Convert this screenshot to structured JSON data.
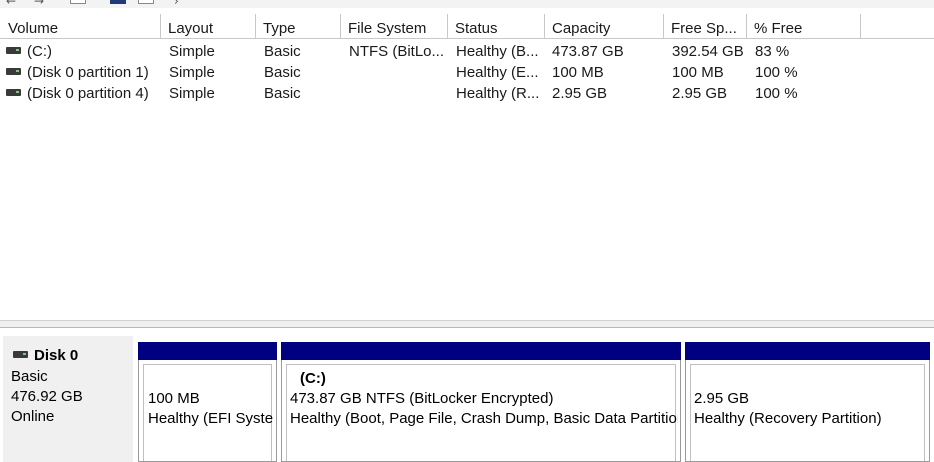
{
  "columns": [
    "Volume",
    "Layout",
    "Type",
    "File System",
    "Status",
    "Capacity",
    "Free Sp...",
    "% Free"
  ],
  "volumes": [
    {
      "volume": "(C:)",
      "layout": "Simple",
      "type": "Basic",
      "fs": "NTFS (BitLo...",
      "status": "Healthy (B...",
      "capacity": "473.87 GB",
      "free": "392.54 GB",
      "pct": "83 %"
    },
    {
      "volume": "(Disk 0 partition 1)",
      "layout": "Simple",
      "type": "Basic",
      "fs": "",
      "status": "Healthy (E...",
      "capacity": "100 MB",
      "free": "100 MB",
      "pct": "100 %"
    },
    {
      "volume": "(Disk 0 partition 4)",
      "layout": "Simple",
      "type": "Basic",
      "fs": "",
      "status": "Healthy (R...",
      "capacity": "2.95 GB",
      "free": "2.95 GB",
      "pct": "100 %"
    }
  ],
  "disk": {
    "name": "Disk 0",
    "type": "Basic",
    "size": "476.92 GB",
    "state": "Online"
  },
  "partitions": [
    {
      "title": "",
      "line1": "100 MB",
      "line2": "Healthy (EFI Syster"
    },
    {
      "title": "(C:)",
      "line1": "473.87 GB NTFS (BitLocker Encrypted)",
      "line2": "Healthy (Boot, Page File, Crash Dump, Basic Data Partition"
    },
    {
      "title": "",
      "line1": "2.95 GB",
      "line2": "Healthy (Recovery Partition)"
    }
  ],
  "colors": {
    "primary_partition_bar": "#000080"
  },
  "icons": {
    "disk": "disk-drive-icon",
    "back": "back-arrow-icon",
    "forward": "forward-arrow-icon"
  }
}
